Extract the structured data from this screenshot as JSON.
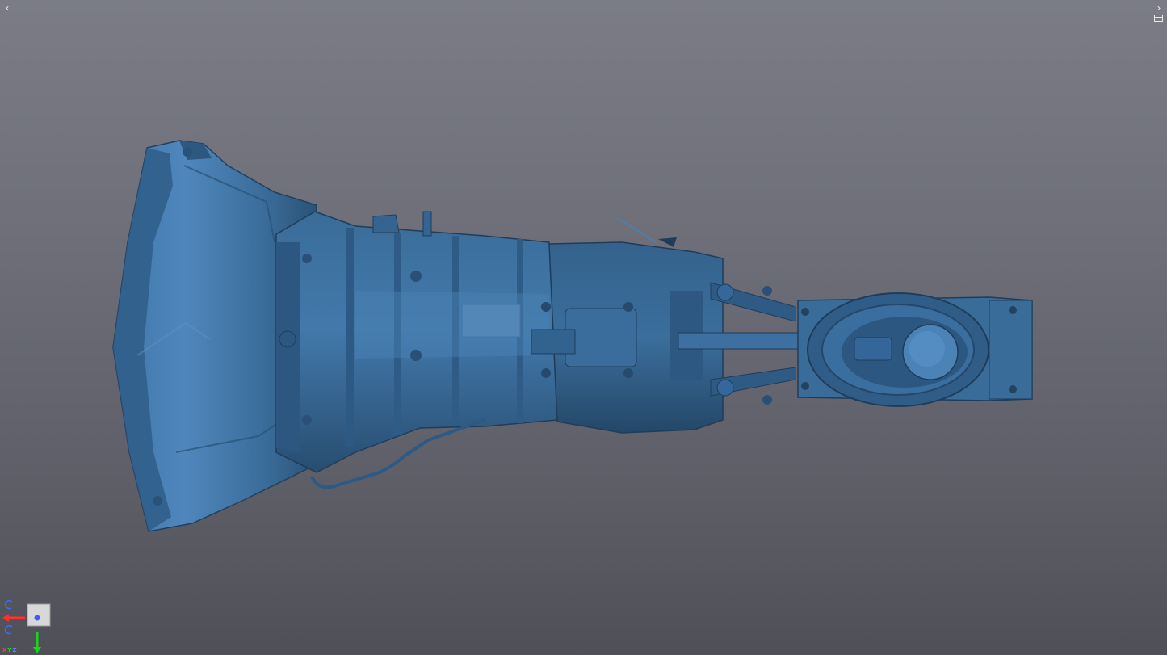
{
  "viewer": {
    "background_top": "#7b7c86",
    "background_bottom": "#4f5057",
    "model_color": "#3a6c99"
  },
  "navigation": {
    "prev_icon": "chevron-left-icon",
    "prev_glyph": "‹",
    "next_icon": "chevron-right-icon",
    "next_glyph": "›",
    "layout_icon": "window-layout-icon"
  },
  "orientation_widget": {
    "axis_x_label": "X",
    "axis_y_label": "Y",
    "axis_z_label": "Z",
    "axis_x_color": "#ff3030",
    "axis_y_color": "#20d020",
    "axis_z_color": "#3a5cff"
  }
}
